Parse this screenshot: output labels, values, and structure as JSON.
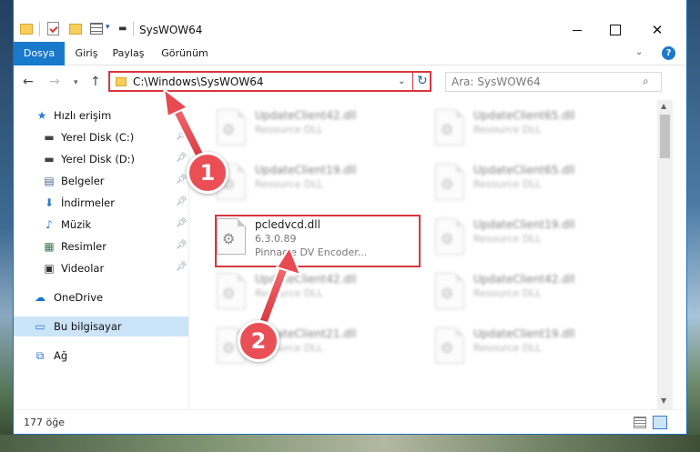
{
  "window": {
    "title": "SysWOW64"
  },
  "ribbon": {
    "tabs": [
      "Dosya",
      "Giriş",
      "Paylaş",
      "Görünüm"
    ],
    "help": "?"
  },
  "address": {
    "path": "C:\\Windows\\SysWOW64"
  },
  "search": {
    "placeholder": "Ara: SysWOW64"
  },
  "sidebar": {
    "items": [
      {
        "label": "Hızlı erişim",
        "icon": "star-icon"
      },
      {
        "label": "Yerel Disk (C:)",
        "icon": "drive-icon"
      },
      {
        "label": "Yerel Disk (D:)",
        "icon": "drive-icon"
      },
      {
        "label": "Belgeler",
        "icon": "document-icon"
      },
      {
        "label": "İndirmeler",
        "icon": "download-icon"
      },
      {
        "label": "Müzik",
        "icon": "music-icon"
      },
      {
        "label": "Resimler",
        "icon": "pictures-icon"
      },
      {
        "label": "Videolar",
        "icon": "video-icon"
      },
      {
        "label": "OneDrive",
        "icon": "cloud-icon"
      },
      {
        "label": "Bu bilgisayar",
        "icon": "computer-icon"
      },
      {
        "label": "Ağ",
        "icon": "network-icon"
      }
    ]
  },
  "files": [
    {
      "name": "UpdateClient42.dll",
      "desc": "Resource DLL"
    },
    {
      "name": "UpdateClient65.dll",
      "desc": "Resource DLL"
    },
    {
      "name": "UpdateClient19.dll",
      "desc": "Resource DLL"
    },
    {
      "name": "UpdateClient65.dll",
      "desc": "Resource DLL"
    },
    {
      "name": "pcledvcd.dll",
      "desc": "6.3.0.89",
      "desc2": "Pinnacle DV Encoder..."
    },
    {
      "name": "UpdateClient19.dll",
      "desc": "Resource DLL"
    },
    {
      "name": "UpdateClient42.dll",
      "desc": "Resource DLL"
    },
    {
      "name": "UpdateClient42.dll",
      "desc": "Resource DLL"
    },
    {
      "name": "UpdateClient21.dll",
      "desc": "Resource DLL"
    },
    {
      "name": "UpdateClient19.dll",
      "desc": "Resource DLL"
    }
  ],
  "status": {
    "count": "177 öğe"
  },
  "annotations": {
    "step1": "1",
    "step2": "2"
  },
  "colors": {
    "accent": "#1979ca",
    "highlight": "#d9363e",
    "badge": "#ea4f55"
  }
}
